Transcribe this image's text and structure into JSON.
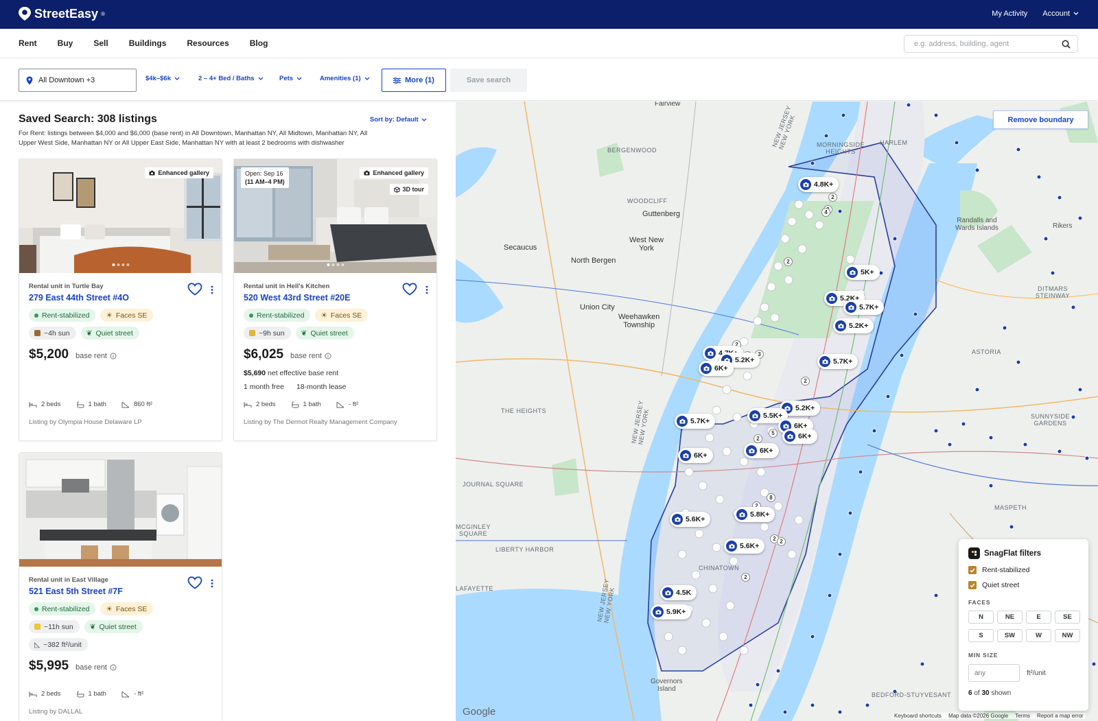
{
  "brand": {
    "name": "StreetEasy",
    "mark": "®"
  },
  "top_links": {
    "activity": "My Activity",
    "account": "Account"
  },
  "nav": {
    "links": [
      "Rent",
      "Buy",
      "Sell",
      "Buildings",
      "Resources",
      "Blog"
    ],
    "search_placeholder": "e.g. address, building, agent"
  },
  "filters": {
    "location": "All Downtown +3",
    "price": "$4k–$6k",
    "beds": "2 – 4+ Bed / Baths",
    "pets": "Pets",
    "amenities": "Amenities (1)",
    "more": "More (1)",
    "save": "Save search"
  },
  "results": {
    "title": "Saved Search: 308 listings",
    "sort": "Sort by: Default",
    "description": "For Rent: listings between $4,000 and $6,000 (base rent) in All Downtown, Manhattan NY, All Midtown, Manhattan NY, All Upper West Side, Manhattan NY or All Upper East Side, Manhattan NY with at least 2 bedrooms with dishwasher"
  },
  "listings": [
    {
      "type": "Rental unit in Turtle Bay",
      "address": "279 East 44th Street #4O",
      "badge": "Enhanced gallery",
      "chip_1": "Rent-stabilized",
      "chip_2": "Faces SE",
      "chip_3": "~4h sun",
      "chip_4": "Quiet street",
      "price": "$5,200",
      "base": "base rent",
      "beds": "2 beds",
      "baths": "1 bath",
      "size": "860 ft²",
      "listed_by": "Listing by Olympia House Delaware LP",
      "photo_count": 4
    },
    {
      "type": "Rental unit in Hell's Kitchen",
      "address": "520 West 43rd Street #20E",
      "badge": "Enhanced gallery",
      "badge_2": "3D tour",
      "open_house_1": "Open: Sep 16",
      "open_house_2": "(11 AM–4 PM)",
      "chip_1": "Rent-stabilized",
      "chip_2": "Faces SE",
      "chip_3": "~9h sun",
      "chip_4": "Quiet street",
      "price": "$6,025",
      "base": "base rent",
      "net_amount": "$5,690",
      "net_label": "net effective base rent",
      "free": "1 month free",
      "lease": "18-month lease",
      "beds": "2 beds",
      "baths": "1 bath",
      "size": "- ft²",
      "listed_by": "Listing by The Dermot Realty Management Company",
      "photo_count": 4
    },
    {
      "type": "Rental unit in East Village",
      "address": "521 East 5th Street #7F",
      "chip_1": "Rent-stabilized",
      "chip_2": "Faces SE",
      "chip_3": "~11h sun",
      "chip_4": "Quiet street",
      "chip_5": "~382 ft²/unit",
      "price": "$5,995",
      "base": "base rent",
      "beds": "2 beds",
      "baths": "1 bath",
      "size": "- ft²",
      "listed_by": "Listing by DALLAL"
    }
  ],
  "map": {
    "remove_boundary": "Remove boundary",
    "labels": {
      "fairview": "Fairview",
      "bergenwood": "BERGENWOOD",
      "woodcliff": "WOODCLIFF",
      "guttenberg": "Guttenberg",
      "secaucus": "Secaucus",
      "west_ny_1": "West New",
      "west_ny_2": "York",
      "north_bergen": "North Bergen",
      "union_city": "Union City",
      "weehawken_1": "Weehawken",
      "weehawken_2": "Township",
      "the_heights": "THE HEIGHTS",
      "journal_square": "JOURNAL SQUARE",
      "mcginley_1": "MCGINLEY",
      "mcginley_2": "SQUARE",
      "liberty_harbor": "LIBERTY HARBOR",
      "lafayette": "LAFAYETTE",
      "morningside_1": "MORNINGSIDE",
      "morningside_2": "HEIGHTS",
      "harlem": "HARLEM",
      "randalls_1": "Randalls and",
      "randalls_2": "Wards Islands",
      "ditmars_1": "DITMARS",
      "ditmars_2": "STEINWAY",
      "astoria": "ASTORIA",
      "sunnyside_1": "SUNNYSIDE",
      "sunnyside_2": "GARDENS",
      "maspeth": "MASPETH",
      "chinatown": "CHINATOWN",
      "bedford": "BEDFORD-STUYVESANT",
      "governors_1": "Governors",
      "governors_2": "Island",
      "nj_ny_1": "NEW JERSEY",
      "nj_ny_2": "NEW YORK",
      "rikers": "Rikers"
    },
    "pins": [
      "4.8K+",
      "5K+",
      "5.2K+",
      "5.7K+",
      "5.2K+",
      "4.7K+",
      "5.2K+",
      "6K+",
      "5.7K+",
      "5.2K+",
      "5.5K+",
      "6K+",
      "6K+",
      "5.7K+",
      "6K+",
      "6K+",
      "5.8K+",
      "5.6K+",
      "5.6K+",
      "4.5K",
      "5.9K+"
    ],
    "cluster_counts": [
      "2",
      "3",
      "4",
      "2",
      "2",
      "3",
      "2",
      "2",
      "5",
      "2",
      "2",
      "8",
      "2",
      "2",
      "2",
      "2"
    ],
    "google": "Google",
    "attribution": [
      "Keyboard shortcuts",
      "Map data ©2026 Google",
      "Terms",
      "Report a map error"
    ],
    "water": "#aadaff",
    "land": "#eef0ee",
    "park": "#c8e6c9",
    "pin_color": "#1a3fa8"
  },
  "snagflat": {
    "title": "SnagFlat filters",
    "check_1": "Rent-stabilized",
    "check_2": "Quiet street",
    "faces_label": "FACES",
    "faces": [
      "N",
      "NE",
      "E",
      "SE",
      "S",
      "SW",
      "W",
      "NW"
    ],
    "min_size_label": "MIN SIZE",
    "min_size_placeholder": "any",
    "unit": "ft²/unit",
    "shown_a": "6",
    "shown_of": "of",
    "shown_b": "30",
    "shown_suffix": "shown"
  },
  "colors": {
    "brand_navy": "#0b1f6b",
    "link_blue": "#1843c7",
    "accent_gold": "#b8862a"
  }
}
